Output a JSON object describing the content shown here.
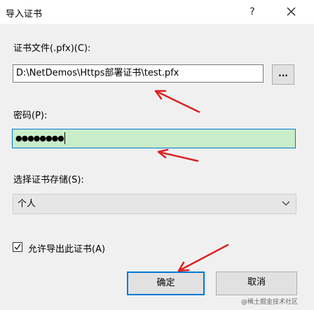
{
  "window": {
    "title": "导入证书",
    "help_label": "?"
  },
  "file": {
    "label": "证书文件(.pfx)(C):",
    "value": "D:\\NetDemos\\Https部署证书\\test.pfx",
    "browse_label": "..."
  },
  "password": {
    "label": "密码(P):",
    "value": "●●●●●●●●"
  },
  "store": {
    "label": "选择证书存储(S):",
    "selected": "个人"
  },
  "exportable": {
    "label": "允许导出此证书(A)",
    "checked": true
  },
  "buttons": {
    "ok": "确定",
    "cancel": "取消"
  },
  "watermark": "@稀土掘金技术社区",
  "colors": {
    "focus": "#0078d7",
    "password_bg": "#c9ecc9",
    "annotation": "#e02020"
  },
  "icons": [
    "close-icon",
    "chevron-down-icon",
    "checkmark-icon"
  ]
}
